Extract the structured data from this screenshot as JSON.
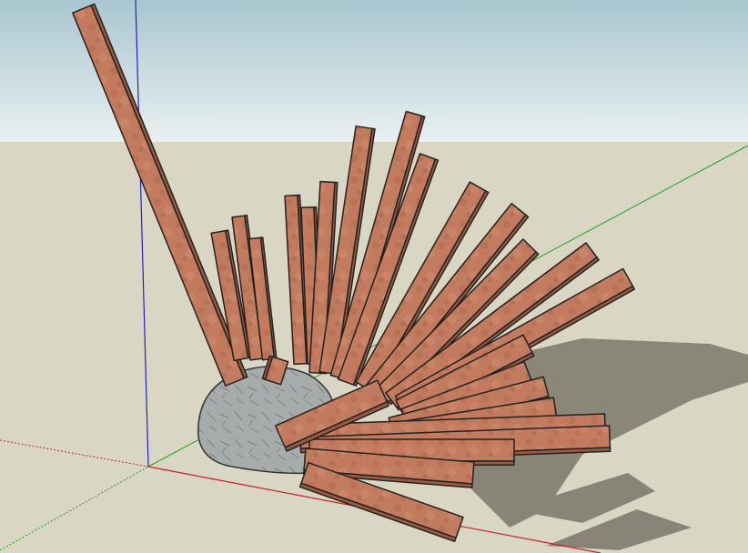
{
  "scene": {
    "sky_color": "#a9c6d0",
    "sky_highlight": "#e6eef0",
    "ground_color": "#d9d6c4",
    "wood_color": "#c07a5c",
    "wood_dark": "#9a5a40",
    "rock_color": "#a9acad",
    "shadow_color": "#7a776a",
    "axis_colors": {
      "red": "#cc2020",
      "green": "#20a020",
      "blue": "#2020cc"
    }
  }
}
